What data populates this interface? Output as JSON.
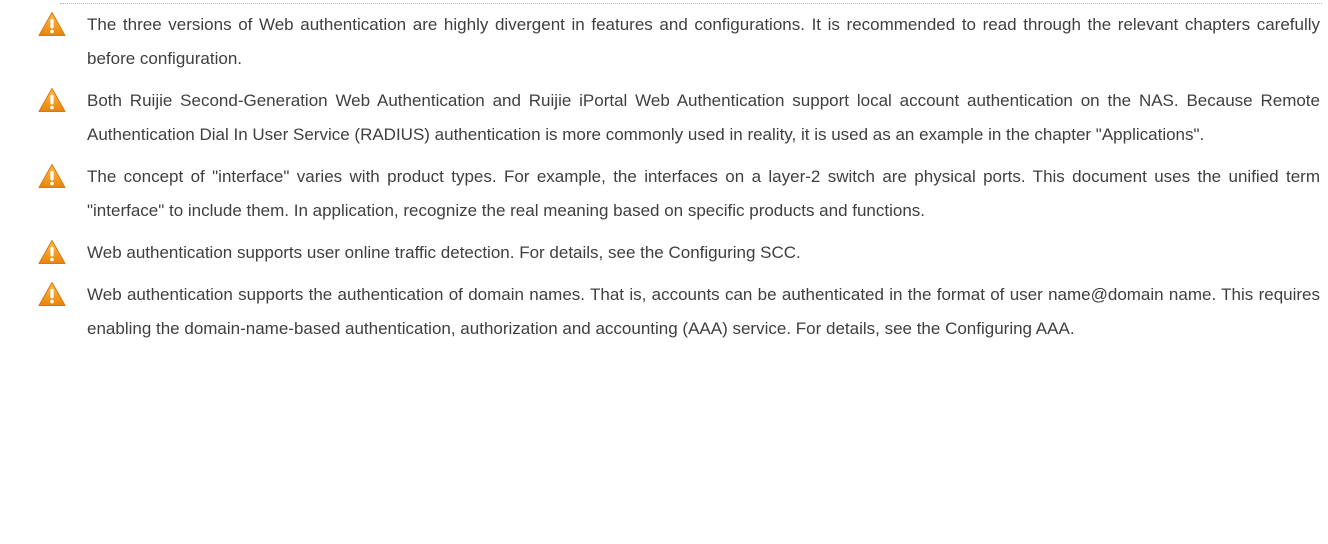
{
  "icons": {
    "warning": "warning-triangle-icon",
    "warning_color": "#f39c12",
    "warning_mark_color": "#ffffff"
  },
  "notes": [
    {
      "text": "The three versions of Web authentication are highly divergent in features and configurations. It is recommended to read through the relevant chapters carefully before configuration."
    },
    {
      "text": "Both Ruijie Second-Generation Web Authentication and Ruijie iPortal Web Authentication support local account authentication on the NAS. Because Remote Authentication Dial In User Service (RADIUS) authentication is more commonly used in reality, it is used as an example in the chapter \"Applications\"."
    },
    {
      "text": "The concept of \"interface\" varies with product types. For example, the interfaces on a layer-2 switch are physical ports. This document uses the unified term \"interface\" to include them. In application, recognize the real meaning based on specific products and functions."
    },
    {
      "text": "Web authentication supports user online traffic detection. For details, see the Configuring SCC."
    },
    {
      "text": "Web authentication supports the authentication of domain names. That is, accounts can be authenticated in the format of user name@domain name. This requires enabling the domain-name-based authentication, authorization and accounting (AAA) service. For details, see the Configuring AAA."
    }
  ]
}
